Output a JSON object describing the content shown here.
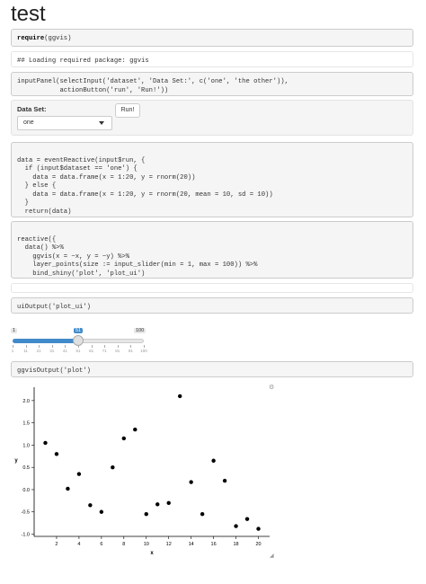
{
  "page": {
    "title": "test"
  },
  "code": {
    "require": {
      "fn": "require",
      "arg": "(ggvis)"
    },
    "loading_msg": "## Loading required package: ggvis",
    "input_panel": [
      "inputPanel(selectInput('dataset', 'Data Set:', c('one', 'the other')),",
      "           actionButton('run', 'Run!'))"
    ],
    "event_reactive": [
      "data = eventReactive(input$run, {",
      "  if (input$dataset == 'one') {",
      "    data = data.frame(x = 1:20, y = rnorm(20))",
      "  } else {",
      "    data = data.frame(x = 1:20, y = rnorm(20, mean = 10, sd = 10))",
      "  }",
      "  return(data)",
      "})"
    ],
    "reactive": [
      "reactive({",
      "  data() %>%",
      "    ggvis(x = ~x, y = ~y) %>%",
      "    layer_points(size := input_slider(min = 1, max = 100)) %>%",
      "    bind_shiny('plot', 'plot_ui')",
      "})"
    ],
    "ui_output": "uiOutput('plot_ui')",
    "ggvis_output": "ggvisOutput('plot')"
  },
  "input_panel": {
    "select_label": "Data Set:",
    "select_value": "one",
    "run_label": "Run!"
  },
  "slider": {
    "min_label": "1",
    "max_label": "100",
    "value_label": "51",
    "value": 51,
    "ticks": [
      "1",
      "11",
      "21",
      "31",
      "41",
      "51",
      "61",
      "71",
      "81",
      "91",
      "100"
    ]
  },
  "icons": {
    "gear": "gear-icon",
    "resize": "resize-handle-icon"
  },
  "chart_data": {
    "type": "scatter",
    "x": [
      1,
      2,
      3,
      4,
      5,
      6,
      7,
      8,
      9,
      10,
      11,
      12,
      13,
      14,
      15,
      16,
      17,
      18,
      19,
      20
    ],
    "y": [
      1.05,
      0.8,
      0.02,
      0.35,
      -0.35,
      -0.5,
      0.5,
      1.15,
      1.35,
      -0.55,
      -0.33,
      -0.3,
      2.1,
      0.17,
      -0.55,
      0.65,
      0.2,
      -0.82,
      -0.66,
      -0.88
    ],
    "xlabel": "x",
    "ylabel": "y",
    "xticks": [
      2,
      4,
      6,
      8,
      10,
      12,
      14,
      16,
      18,
      20
    ],
    "yticks": [
      -1.0,
      -0.5,
      0.0,
      0.5,
      1.0,
      1.5,
      2.0
    ],
    "ytick_labels": [
      "-1.0",
      "-0.5",
      "0.0",
      "0.5",
      "1.0",
      "1.5",
      "2.0"
    ],
    "xlim": [
      0,
      21
    ],
    "ylim": [
      -1.05,
      2.3
    ],
    "grid": false
  }
}
